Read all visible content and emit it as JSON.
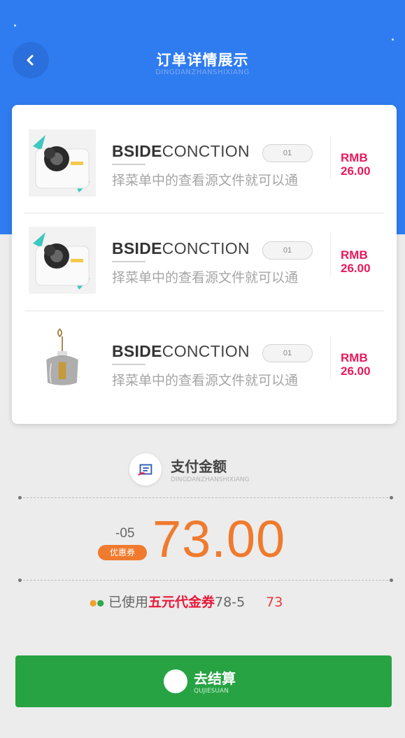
{
  "header": {
    "title": "订单详情展示",
    "subtitle": "DINGDANZHANSHIXIANG"
  },
  "colors": {
    "primary": "#2f7cf0",
    "price": "#e8195a",
    "accent": "#f07a2d",
    "checkout": "#27a343"
  },
  "items": [
    {
      "brand_bold": "BSIDE",
      "brand_light": "CONCTION",
      "qty": "01",
      "desc": "择菜单中的查看源文件就可以通",
      "currency": "RMB",
      "price": "26.00",
      "image": "camera-product"
    },
    {
      "brand_bold": "BSIDE",
      "brand_light": "CONCTION",
      "qty": "01",
      "desc": "择菜单中的查看源文件就可以通",
      "currency": "RMB",
      "price": "26.00",
      "image": "camera-product"
    },
    {
      "brand_bold": "BSIDE",
      "brand_light": "CONCTION",
      "qty": "01",
      "desc": "择菜单中的查看源文件就可以通",
      "currency": "RMB",
      "price": "26.00",
      "image": "pendant-lamp"
    }
  ],
  "payment": {
    "title": "支付金额",
    "subtitle": "DINGDANZHANSHIXIANG",
    "icon": "payment-icon",
    "discount": "-05",
    "coupon_badge": "优惠券",
    "amount": "73.00"
  },
  "coupon_used": {
    "prefix": "已使用",
    "coupon_name": "五元代金券",
    "calc": "78-5",
    "total": "73"
  },
  "checkout": {
    "label": "去结算",
    "sub": "QUJIESUAN"
  }
}
